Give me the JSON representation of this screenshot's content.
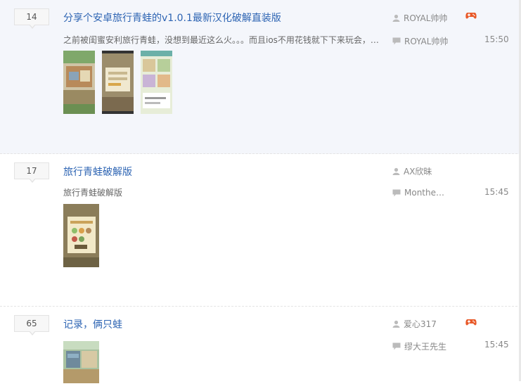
{
  "threads": [
    {
      "count": "14",
      "title": "分享个安卓旅行青蛙的v1.0.1最新汉化破解直装版",
      "abstract": "之前被闺蜜安利旅行青蛙，没想到最近这么火。。。而且ios不用花钱就下下来玩会，…",
      "author": "ROYAL帅帅",
      "last_reply_user": "ROYAL帅帅",
      "time": "15:50",
      "has_game_icon": true,
      "thumb_count": 3
    },
    {
      "count": "17",
      "title": "旅行青蛙破解版",
      "abstract": "旅行青蛙破解版",
      "author": "AX欣昧",
      "last_reply_user": "Monther…",
      "time": "15:45",
      "has_game_icon": false,
      "thumb_count": 1
    },
    {
      "count": "65",
      "title": "记录，俩只蛙",
      "abstract": "",
      "author": "爱心317",
      "last_reply_user": "缪大王先生",
      "time": "15:45",
      "has_game_icon": true,
      "thumb_count": 1
    }
  ],
  "icons": {
    "author": "user-icon",
    "reply": "reply-bubble-icon",
    "game": "game-controller-icon"
  },
  "colors": {
    "title_link": "#2d64b3",
    "hover_bg": "#f4f6fb",
    "game_icon": "#e85a2a"
  }
}
